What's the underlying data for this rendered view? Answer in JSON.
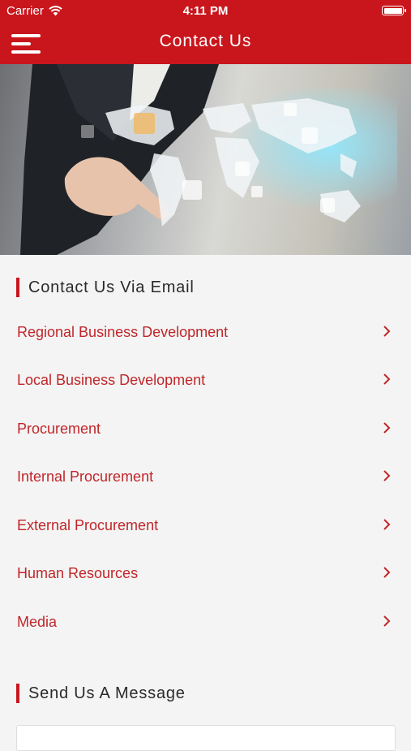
{
  "status_bar": {
    "carrier": "Carrier",
    "time": "4:11 PM"
  },
  "navbar": {
    "title": "Contact Us"
  },
  "hero": {
    "icon": "businessman-touching-world-map-image"
  },
  "email_section": {
    "title": "Contact Us Via Email",
    "items": [
      {
        "label": "Regional Business Development"
      },
      {
        "label": "Local Business Development"
      },
      {
        "label": "Procurement"
      },
      {
        "label": "Internal Procurement"
      },
      {
        "label": "External Procurement"
      },
      {
        "label": "Human Resources"
      },
      {
        "label": "Media"
      }
    ]
  },
  "message_section": {
    "title": "Send Us A Message"
  },
  "colors": {
    "brand_red": "#c9161c",
    "link_red": "#c0262a",
    "background": "#f4f4f4"
  }
}
